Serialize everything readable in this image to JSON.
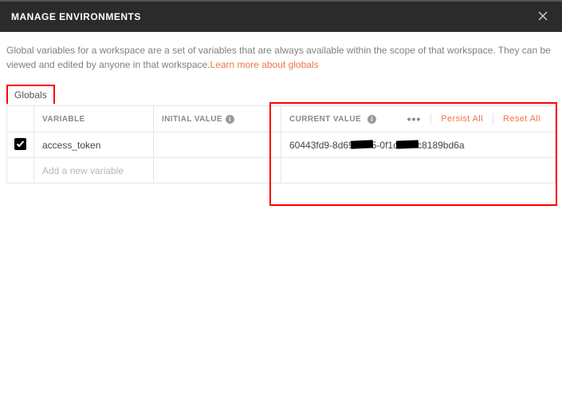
{
  "titlebar": {
    "title": "MANAGE ENVIRONMENTS"
  },
  "description": {
    "text": "Global variables for a workspace are a set of variables that are always available within the scope of that workspace. They can be viewed and edited by anyone in that workspace.",
    "link_text": "Learn more about globals"
  },
  "tabs": {
    "globals": "Globals"
  },
  "table": {
    "headers": {
      "variable": "VARIABLE",
      "initial_value": "INITIAL VALUE",
      "current_value": "CURRENT VALUE"
    },
    "actions": {
      "persist_all": "Persist All",
      "reset_all": "Reset All"
    },
    "rows": [
      {
        "checked": true,
        "variable": "access_token",
        "initial_value": "",
        "current_value_prefix": "60443fd9-8d69",
        "current_value_mid": "5-0f1c",
        "current_value_suffix": "c8189bd6a"
      }
    ],
    "placeholder": "Add a new variable"
  }
}
